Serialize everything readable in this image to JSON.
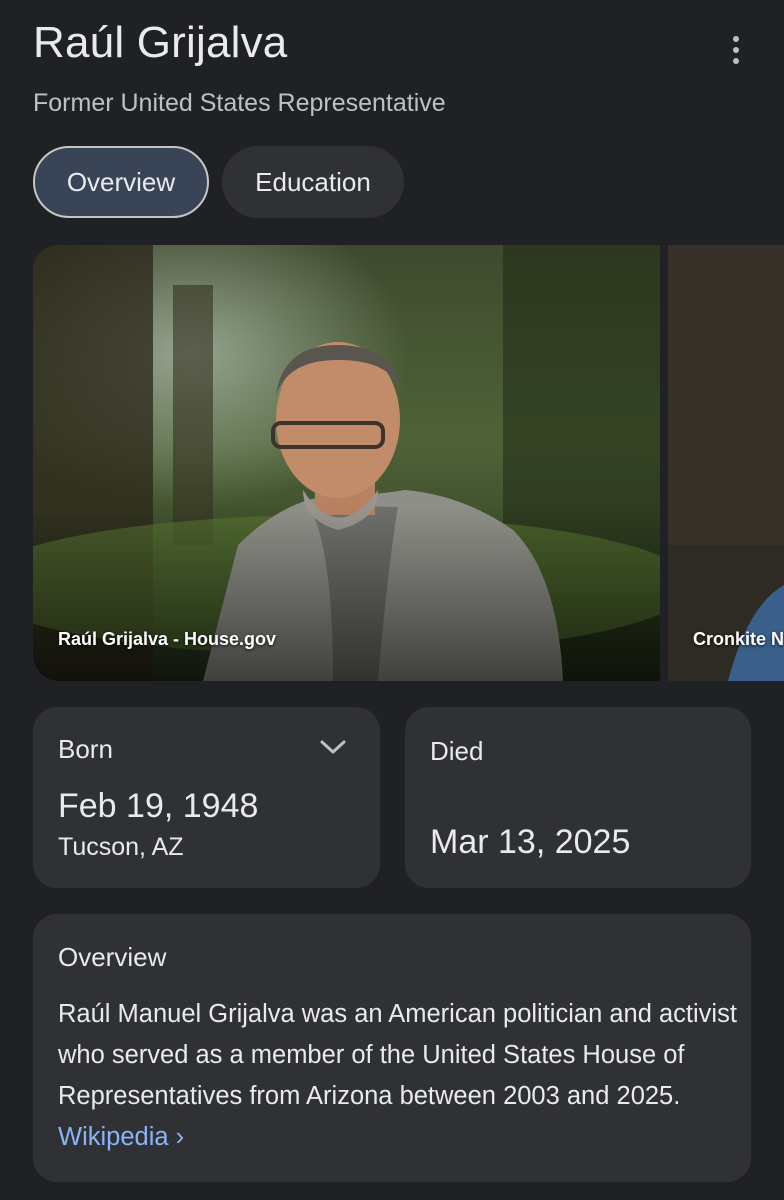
{
  "header": {
    "title": "Raúl Grijalva",
    "subtitle": "Former United States Representative"
  },
  "tabs": [
    {
      "label": "Overview",
      "active": true
    },
    {
      "label": "Education",
      "active": false
    }
  ],
  "images": [
    {
      "caption": "Raúl Grijalva - House.gov"
    },
    {
      "caption": "Cronkite N"
    }
  ],
  "born": {
    "label": "Born",
    "date": "Feb 19, 1948",
    "place": "Tucson, AZ"
  },
  "died": {
    "label": "Died",
    "date": "Mar 13, 2025"
  },
  "overview": {
    "heading": "Overview",
    "text": "Raúl Manuel Grijalva was an American politician and activist who served as a member of the United States House of Representatives from Arizona between 2003 and 2025.",
    "source_link": "Wikipedia ›"
  },
  "colors": {
    "background": "#202124",
    "card": "#303134",
    "active_tab": "#394457",
    "link": "#8ab4f8"
  }
}
